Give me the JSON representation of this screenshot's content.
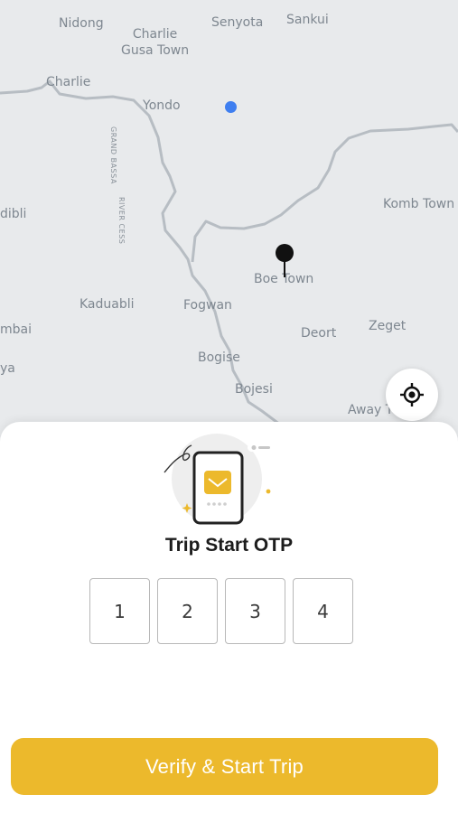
{
  "map": {
    "places": {
      "nidong": "Nidong",
      "charlie_gusa_1": "Charlie",
      "charlie_gusa_2": "Gusa Town",
      "senyota": "Senyota",
      "sankui": "Sankui",
      "charlie": "Charlie",
      "yondo": "Yondo",
      "dibli": "dibli",
      "kombtown": "Komb Town",
      "boetown": "Boe Town",
      "kaduabli": "Kaduabli",
      "fogwan": "Fogwan",
      "deort": "Deort",
      "zeget": "Zeget",
      "mbai": "mbai",
      "ya": "ya",
      "bogise": "Bogise",
      "bojesi": "Bojesi",
      "awaytown": "Away T"
    },
    "region_labels": {
      "grand_bassa": "GRAND BASSA",
      "river_cess": "RIVER CESS"
    },
    "colors": {
      "background": "#e8eaec",
      "border": "#b7bdc3",
      "user_location": "#3f7ff0"
    },
    "icons": {
      "pin": "map-pin-icon",
      "locate": "crosshair-icon"
    }
  },
  "sheet": {
    "illustration": "phone-envelope-icon",
    "title": "Trip Start OTP",
    "otp_digits": [
      "1",
      "2",
      "3",
      "4"
    ],
    "primary_button": "Verify & Start Trip",
    "accent_color": "#ecb92c"
  }
}
